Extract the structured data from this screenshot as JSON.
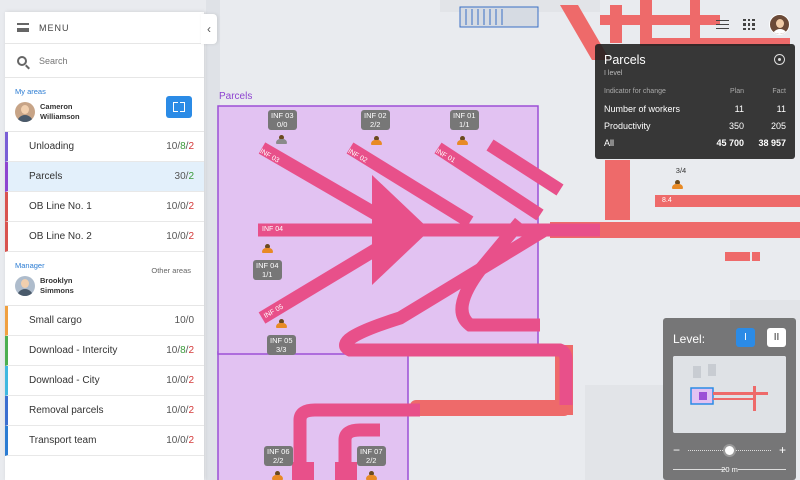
{
  "menu": {
    "title": "MENU",
    "search_placeholder": "Search",
    "collapse_icon": "chevron-left-icon"
  },
  "my_areas": {
    "label": "My areas",
    "person": "Cameron Williamson",
    "items": [
      {
        "name": "Unloading",
        "total": "10",
        "green": "8",
        "red": "2",
        "color": "#7a5fd6"
      },
      {
        "name": "Parcels",
        "total": "30",
        "green": "2",
        "red": "",
        "color": "#8e44d0",
        "active": true
      },
      {
        "name": "OB Line No. 1",
        "total": "10",
        "green": "0",
        "red": "2",
        "color": "#d9534f"
      },
      {
        "name": "OB Line No. 2",
        "total": "10",
        "green": "0",
        "red": "2",
        "color": "#d9534f"
      }
    ]
  },
  "manager": {
    "label": "Manager",
    "other_label": "Other areas",
    "person": "Brooklyn Simmons",
    "items": [
      {
        "name": "Small cargo",
        "total": "10",
        "green": "0",
        "red": "",
        "color": "#f0a040"
      },
      {
        "name": "Download - Intercity",
        "total": "10",
        "green": "8",
        "red": "2",
        "color": "#4caf50"
      },
      {
        "name": "Download - City",
        "total": "10",
        "green": "0",
        "red": "2",
        "color": "#3fb8e0"
      },
      {
        "name": "Removal parcels",
        "total": "10",
        "green": "0",
        "red": "2",
        "color": "#3b6fd0"
      },
      {
        "name": "Transport team",
        "total": "10",
        "green": "0",
        "red": "2",
        "color": "#2b7cd3"
      }
    ]
  },
  "map": {
    "zone_label": "Parcels",
    "tags": [
      {
        "id": "inf03",
        "line1": "INF 03",
        "line2": "0/0"
      },
      {
        "id": "inf02",
        "line1": "INF 02",
        "line2": "2/2"
      },
      {
        "id": "inf01",
        "line1": "INF 01",
        "line2": "1/1"
      },
      {
        "id": "inf04",
        "line1": "INF 04",
        "line2": "1/1"
      },
      {
        "id": "inf05",
        "line1": "INF 05",
        "line2": "3/3"
      },
      {
        "id": "inf06",
        "line1": "INF 06",
        "line2": "2/2"
      },
      {
        "id": "inf07",
        "line1": "INF 07",
        "line2": "2/2"
      }
    ],
    "belt_labels": {
      "b1": "INF 03",
      "b2": "INF 02",
      "b3": "INF 01",
      "b4": "INF 04",
      "b5": "INF 05",
      "right_count": "3/4",
      "right_value": "8.4"
    }
  },
  "info_panel": {
    "title": "Parcels",
    "subtitle": "I level",
    "head": {
      "indicator": "Indicator for change",
      "plan": "Plan",
      "fact": "Fact"
    },
    "rows": [
      {
        "indicator": "Number of workers",
        "plan": "11",
        "fact": "11"
      },
      {
        "indicator": "Productivity",
        "plan": "350",
        "fact": "205"
      },
      {
        "indicator": "All",
        "plan": "45 700",
        "fact": "38 957"
      }
    ]
  },
  "level_panel": {
    "label": "Level:",
    "level1": "I",
    "level2": "II",
    "zoom_minus": "−",
    "zoom_plus": "+",
    "scale": "20 m",
    "zoom_level": 0.5
  },
  "colors": {
    "belt_pink": "#e8508a",
    "belt_red": "#ee6a6a",
    "zone_fill": "#e2c2f2",
    "zone_border": "#9c4fd6",
    "accent": "#2b8be6"
  }
}
